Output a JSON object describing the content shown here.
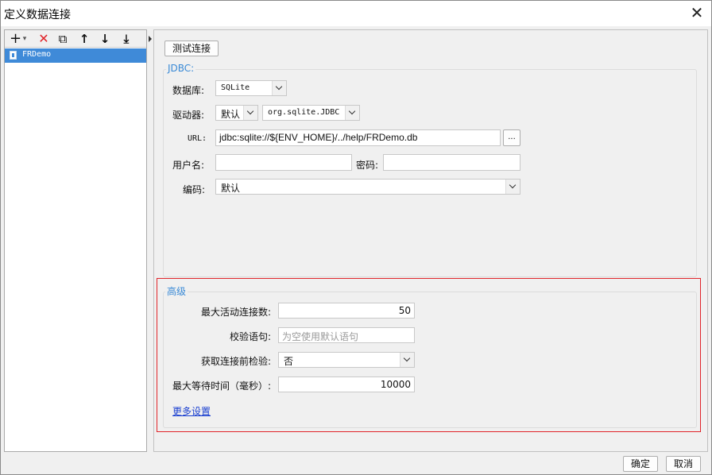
{
  "window": {
    "title": "定义数据连接",
    "close_glyph": "✕"
  },
  "toolbar": {
    "add": "+",
    "add_dropdown": "▾",
    "delete": "✕",
    "copy": "⧉",
    "move_up": "↑",
    "move_down": "↓",
    "sort": "⤓"
  },
  "connections": [
    {
      "name": "FRDemo",
      "icon": "database-icon"
    }
  ],
  "main": {
    "test_button": "测试连接",
    "jdbc": {
      "legend": "JDBC:",
      "database_label": "数据库:",
      "database_value": "SQLite",
      "driver_label": "驱动器:",
      "driver_mode": "默认",
      "driver_class": "org.sqlite.JDBC",
      "url_label": "URL:",
      "url_value": "jdbc:sqlite://${ENV_HOME}/../help/FRDemo.db",
      "url_browse": "...",
      "username_label": "用户名:",
      "username_value": "",
      "password_label": "密码:",
      "password_value": "",
      "encoding_label": "编码:",
      "encoding_value": "默认"
    },
    "advanced": {
      "legend": "高级",
      "max_active_label": "最大活动连接数:",
      "max_active_value": "50",
      "validation_label": "校验语句:",
      "validation_placeholder": "为空使用默认语句",
      "test_before_label": "获取连接前检验:",
      "test_before_value": "否",
      "max_wait_label": "最大等待时间（毫秒）:",
      "max_wait_value": "10000",
      "more_settings": "更多设置"
    }
  },
  "footer": {
    "ok": "确定",
    "cancel": "取消"
  },
  "colors": {
    "selection": "#3f8ad8",
    "legend": "#3a8ad6",
    "highlight_border": "#e0242a",
    "link": "#1a3fd0"
  }
}
